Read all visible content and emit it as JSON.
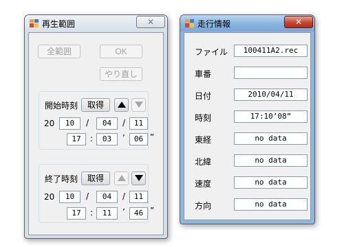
{
  "playback_window": {
    "title": "再生範囲",
    "close_glyph": "✕",
    "all_range_label": "全範囲",
    "ok_label": "OK",
    "redo_label": "やり直し",
    "start": {
      "label": "開始時刻",
      "get_label": "取得",
      "up_icon": "triangle-up-icon",
      "down_icon": "triangle-down-icon",
      "century": "20",
      "year": "10",
      "month": "04",
      "day": "11",
      "hour": "17",
      "minute": "03",
      "second": "06",
      "date_sep": "/",
      "time_sep_hm": ":",
      "min_mark": "’",
      "sec_mark": "”"
    },
    "end": {
      "label": "終了時刻",
      "get_label": "取得",
      "up_icon": "triangle-up-icon",
      "down_icon": "triangle-down-icon",
      "century": "20",
      "year": "10",
      "month": "04",
      "day": "11",
      "hour": "17",
      "minute": "11",
      "second": "46",
      "date_sep": "/",
      "time_sep_hm": ":",
      "min_mark": "’",
      "sec_mark": "”"
    }
  },
  "driving_window": {
    "title": "走行情報",
    "close_glyph": "✕",
    "rows": [
      {
        "label": "ファイル",
        "value": "100411A2.rec"
      },
      {
        "label": "車番",
        "value": ""
      },
      {
        "label": "日付",
        "value": "2010/04/11"
      },
      {
        "label": "時刻",
        "value": "17:10’08”"
      },
      {
        "label": "東経",
        "value": "no data"
      },
      {
        "label": "北緯",
        "value": "no data"
      },
      {
        "label": "速度",
        "value": "no data"
      },
      {
        "label": "方向",
        "value": "no data"
      }
    ]
  },
  "colors": {
    "inactive_frame": "#d6dee7",
    "active_frame": "#8eb7de",
    "close_active": "#c8462f",
    "client_bg": "#f0f0f0"
  }
}
